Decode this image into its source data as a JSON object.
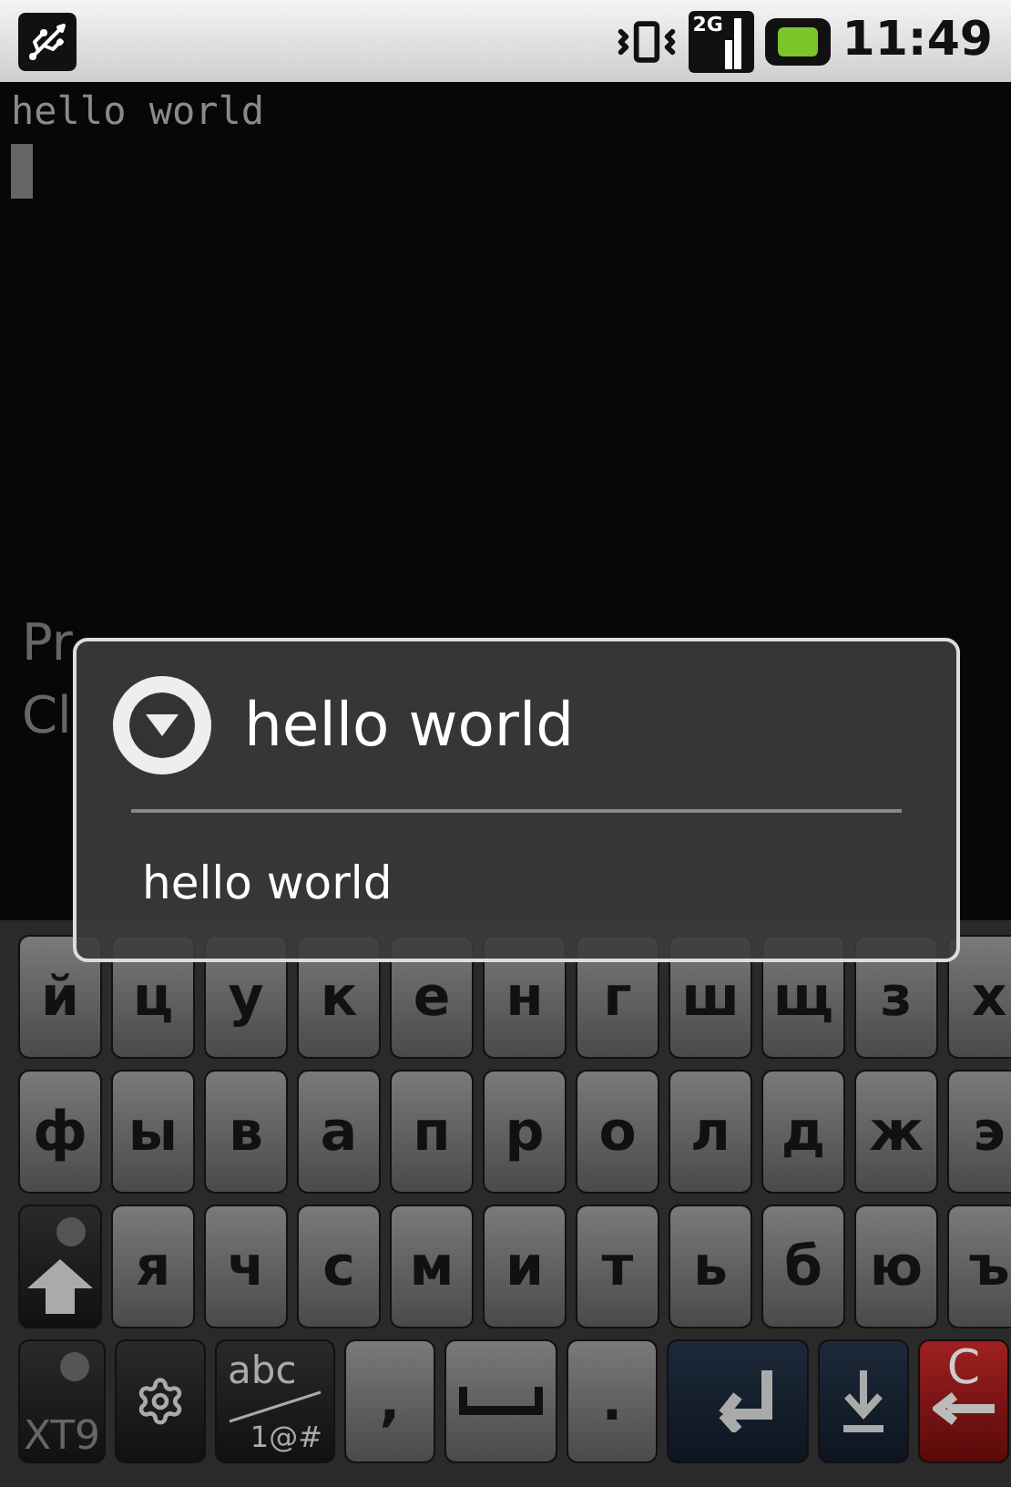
{
  "status_bar": {
    "network": "2G",
    "time": "11:49"
  },
  "terminal": {
    "lines": [
      "hello world"
    ],
    "cursor": true
  },
  "exit_dialog": {
    "message": [
      "Pr",
      "Cl"
    ]
  },
  "popup": {
    "title": "hello world",
    "items": [
      "hello world"
    ]
  },
  "keyboard": {
    "rows": [
      [
        {
          "kind": "letter",
          "label": "й"
        },
        {
          "kind": "letter",
          "label": "ц"
        },
        {
          "kind": "letter",
          "label": "у"
        },
        {
          "kind": "letter",
          "label": "к"
        },
        {
          "kind": "letter",
          "label": "е"
        },
        {
          "kind": "letter",
          "label": "н"
        },
        {
          "kind": "letter",
          "label": "г"
        },
        {
          "kind": "letter",
          "label": "ш"
        },
        {
          "kind": "letter",
          "label": "щ"
        },
        {
          "kind": "letter",
          "label": "з"
        },
        {
          "kind": "letter",
          "label": "х"
        }
      ],
      [
        {
          "kind": "letter",
          "label": "ф"
        },
        {
          "kind": "letter",
          "label": "ы"
        },
        {
          "kind": "letter",
          "label": "в"
        },
        {
          "kind": "letter",
          "label": "а"
        },
        {
          "kind": "letter",
          "label": "п"
        },
        {
          "kind": "letter",
          "label": "р"
        },
        {
          "kind": "letter",
          "label": "о"
        },
        {
          "kind": "letter",
          "label": "л"
        },
        {
          "kind": "letter",
          "label": "д"
        },
        {
          "kind": "letter",
          "label": "ж"
        },
        {
          "kind": "letter",
          "label": "э"
        }
      ],
      [
        {
          "kind": "shift",
          "on": false
        },
        {
          "kind": "letter",
          "label": "я"
        },
        {
          "kind": "letter",
          "label": "ч"
        },
        {
          "kind": "letter",
          "label": "с"
        },
        {
          "kind": "letter",
          "label": "м"
        },
        {
          "kind": "letter",
          "label": "и"
        },
        {
          "kind": "letter",
          "label": "т"
        },
        {
          "kind": "letter",
          "label": "ь"
        },
        {
          "kind": "letter",
          "label": "б"
        },
        {
          "kind": "letter",
          "label": "ю"
        },
        {
          "kind": "letter",
          "label": "ъ"
        }
      ]
    ],
    "bottom_row": [
      {
        "kind": "xt9",
        "label": "XT9",
        "on": false
      },
      {
        "kind": "settings"
      },
      {
        "kind": "symbols",
        "label": "abc",
        "label2": "1@#"
      },
      {
        "kind": "letter",
        "label": ","
      },
      {
        "kind": "space"
      },
      {
        "kind": "letter",
        "label": "."
      },
      {
        "kind": "enter"
      },
      {
        "kind": "hide"
      },
      {
        "kind": "delete",
        "label": "C"
      }
    ]
  }
}
